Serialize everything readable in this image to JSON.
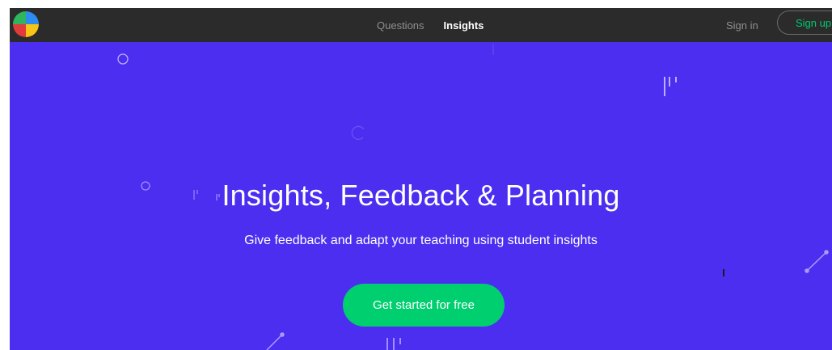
{
  "nav": {
    "links": [
      {
        "label": "Questions",
        "active": false
      },
      {
        "label": "Insights",
        "active": true
      }
    ],
    "sign_in": "Sign in",
    "sign_up": "Sign up"
  },
  "hero": {
    "title": "Insights, Feedback & Planning",
    "subtitle": "Give feedback and adapt your teaching using student insights",
    "cta": "Get started for free"
  },
  "colors": {
    "navbar": "#2b2b2b",
    "hero_background": "#4b2ef0",
    "accent_green": "#00cf6f",
    "logo": [
      "#e23b3b",
      "#f5c518",
      "#2d8cf0",
      "#2fb55d"
    ]
  }
}
